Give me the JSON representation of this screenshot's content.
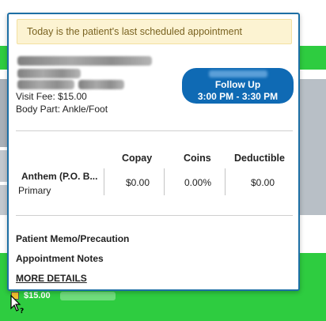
{
  "notice": "Today is the patient's last scheduled appointment",
  "visit_fee": "Visit Fee: $15.00",
  "body_part": "Body Part: Ankle/Foot",
  "appointment_button": {
    "line1": "Follow Up",
    "line2": "3:00 PM - 3:30 PM"
  },
  "insurance": {
    "headers": [
      "Copay",
      "Coins",
      "Deductible"
    ],
    "name": "Anthem (P.O. B...",
    "type": "Primary",
    "copay": "$0.00",
    "coins": "0.00%",
    "deductible": "$0.00"
  },
  "sections": {
    "memo": "Patient Memo/Precaution",
    "notes": "Appointment Notes",
    "more_details": "MORE DETAILS"
  },
  "bottom_price": "$15.00",
  "colors": {
    "accent": "#0f6ab4",
    "calendar_green": "#2ecc40",
    "notice_bg": "#fcf3d2"
  }
}
